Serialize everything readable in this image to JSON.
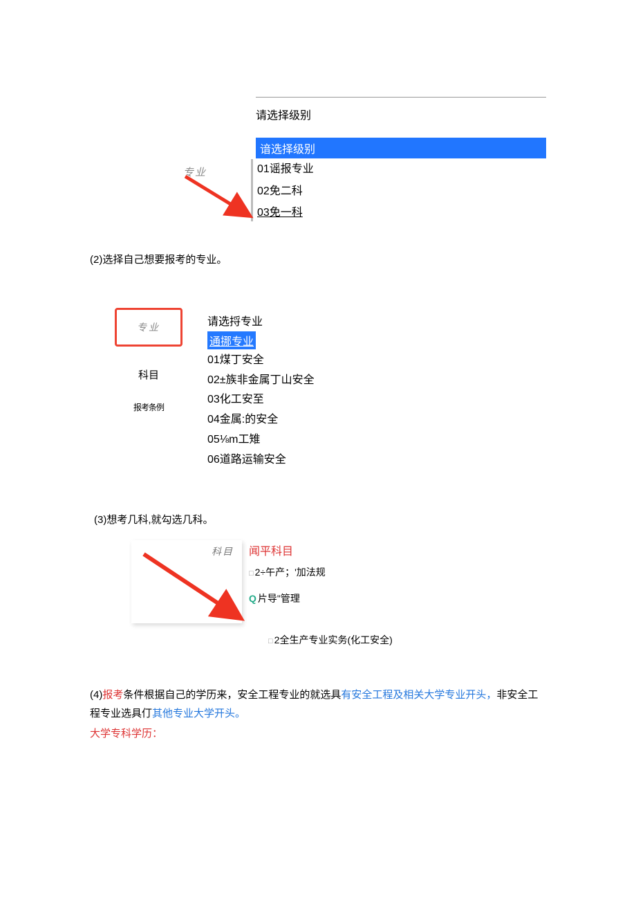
{
  "section1": {
    "zhuanye_label": "专业",
    "label": "请选择级别",
    "selected": "谙选择级别",
    "options": [
      "01谣报专业",
      "02免二科",
      "03免一科"
    ]
  },
  "para1": "(2)选择自己想要报考的专业。",
  "section2": {
    "zhuanye_label": "专业",
    "kemu_label": "科目",
    "baokao_label": "报考条例",
    "select_label": "请选捋专业",
    "selected": "通挪专业",
    "options": [
      "01煤丁安全",
      "02±族非金属丁山安全",
      "03化工安至",
      "04金属:的安全",
      "05⅛m工雉",
      "06道路运输安全"
    ]
  },
  "para3": "(3)想考几科,就勾选几科。",
  "section3": {
    "kemu_label": "科目",
    "wenping": "闻平科目",
    "chk1": "2÷午产；'加法规",
    "chk2": "片导\"管理",
    "chk3": "2全生产专业实务(化工安全)"
  },
  "para4": {
    "p1a": "(4)",
    "p1b": "报考",
    "p1c": "条件根据自己的学历来，安全工程专业的就选具",
    "p1d": "有安全工程及相关大学专业开头，",
    "p1e": "非安全工程专业选具仃",
    "p1f": "其他专业大学开头。",
    "p2": "大学专科学历："
  }
}
